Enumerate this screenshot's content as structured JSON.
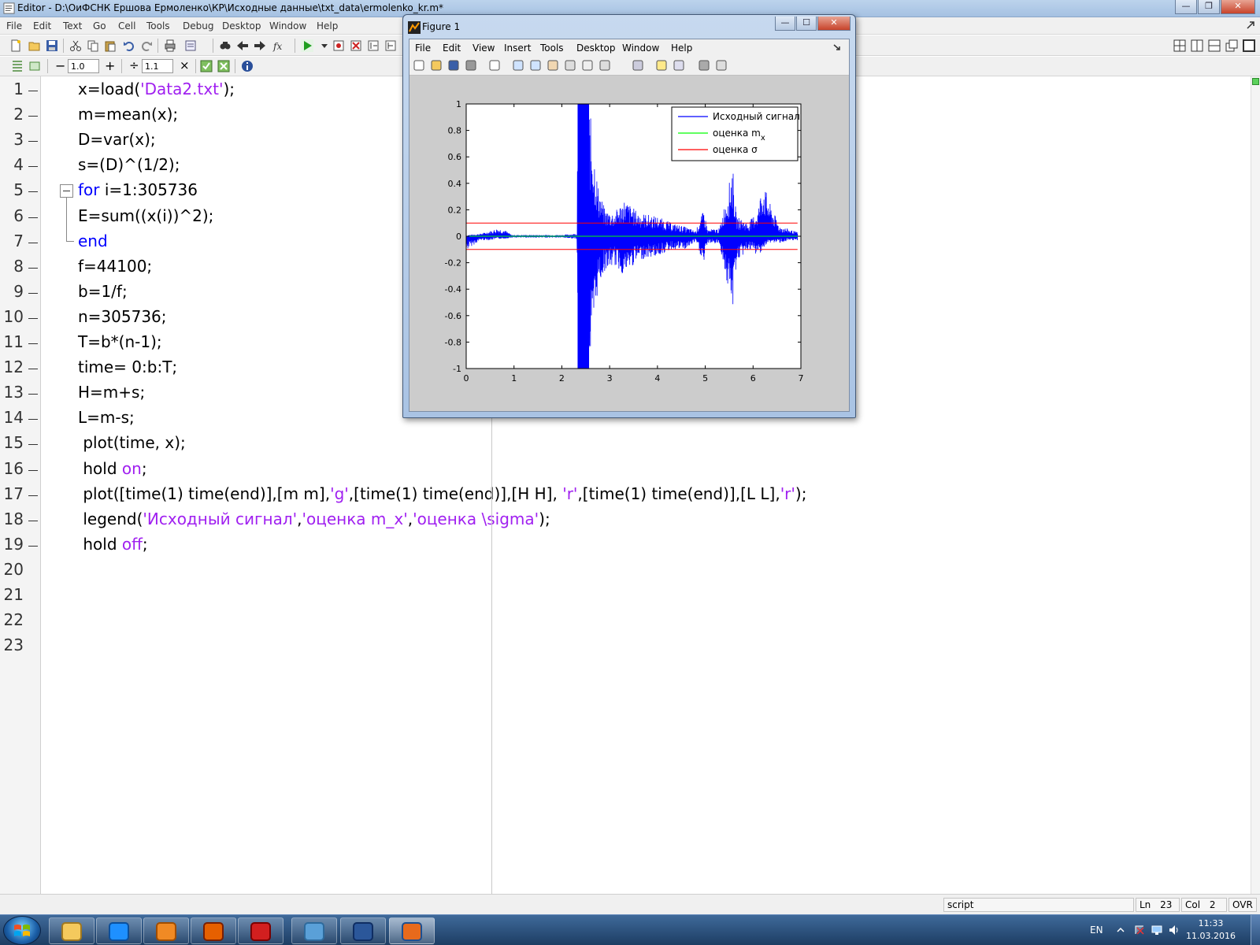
{
  "editor": {
    "title": "Editor - D:\\ОиФСНК Ершова Ермоленко\\КР\\Исходные данные\\txt_data\\ermolenko_kr.m*",
    "menu": [
      "File",
      "Edit",
      "Text",
      "Go",
      "Cell",
      "Tools",
      "Debug",
      "Desktop",
      "Window",
      "Help"
    ],
    "cell_toolbar": {
      "minus": "−",
      "value1": "1.0",
      "plus": "+",
      "divide": "÷",
      "value2": "1.1",
      "times": "×"
    },
    "line_numbers": [
      "1",
      "2",
      "3",
      "4",
      "5",
      "6",
      "7",
      "8",
      "9",
      "10",
      "11",
      "12",
      "13",
      "14",
      "15",
      "16",
      "17",
      "18",
      "19",
      "20",
      "21",
      "22",
      "23"
    ],
    "code": [
      [
        {
          "t": "x=load(",
          "c": ""
        },
        {
          "t": "'Data2.txt'",
          "c": "str"
        },
        {
          "t": ");",
          "c": ""
        }
      ],
      [
        {
          "t": "m=mean(x);",
          "c": ""
        }
      ],
      [
        {
          "t": "D=var(x);",
          "c": ""
        }
      ],
      [
        {
          "t": "s=(D)^(1/2);",
          "c": ""
        }
      ],
      [
        {
          "t": "for",
          "c": "kw"
        },
        {
          "t": " i=1:305736",
          "c": ""
        }
      ],
      [
        {
          "t": "E=sum((x(i))^2);",
          "c": ""
        }
      ],
      [
        {
          "t": "end",
          "c": "kw"
        }
      ],
      [
        {
          "t": "f=44100;",
          "c": ""
        }
      ],
      [
        {
          "t": "b=1/f;",
          "c": ""
        }
      ],
      [
        {
          "t": "n=305736;",
          "c": ""
        }
      ],
      [
        {
          "t": "T=b*(n-1);",
          "c": ""
        }
      ],
      [
        {
          "t": "time= 0:b:T;",
          "c": ""
        }
      ],
      [
        {
          "t": "H=m+s;",
          "c": ""
        }
      ],
      [
        {
          "t": "L=m-s;",
          "c": ""
        }
      ],
      [
        {
          "t": " plot(time, x);",
          "c": ""
        }
      ],
      [
        {
          "t": " hold ",
          "c": ""
        },
        {
          "t": "on",
          "c": "str"
        },
        {
          "t": ";",
          "c": ""
        }
      ],
      [
        {
          "t": " plot([time(1) time(end)],[m m],",
          "c": ""
        },
        {
          "t": "'g'",
          "c": "str"
        },
        {
          "t": ",[time(1) time(end)],[H H], ",
          "c": ""
        },
        {
          "t": "'r'",
          "c": "str"
        },
        {
          "t": ",[time(1) time(end)],[L L],",
          "c": ""
        },
        {
          "t": "'r'",
          "c": "str"
        },
        {
          "t": ");",
          "c": ""
        }
      ],
      [
        {
          "t": " legend(",
          "c": ""
        },
        {
          "t": "'Исходный сигнал'",
          "c": "str"
        },
        {
          "t": ",",
          "c": ""
        },
        {
          "t": "'оценка m_x'",
          "c": "str"
        },
        {
          "t": ",",
          "c": ""
        },
        {
          "t": "'оценка \\sigma'",
          "c": "str"
        },
        {
          "t": ");",
          "c": ""
        }
      ],
      [
        {
          "t": " hold ",
          "c": ""
        },
        {
          "t": "off",
          "c": "str"
        },
        {
          "t": ";",
          "c": ""
        }
      ],
      [],
      [],
      [],
      []
    ],
    "status": {
      "mode": "script",
      "ln_label": "Ln",
      "ln": "23",
      "col_label": "Col",
      "col": "2",
      "ovr": "OVR"
    }
  },
  "figure": {
    "title": "Figure 1",
    "menu": [
      "File",
      "Edit",
      "View",
      "Insert",
      "Tools",
      "Desktop",
      "Window",
      "Help"
    ],
    "icons": [
      "new-figure-icon",
      "open-file-icon",
      "save-icon",
      "print-icon",
      "pointer-icon",
      "zoom-in-icon",
      "zoom-out-icon",
      "pan-icon",
      "rotate-3d-icon",
      "data-cursor-icon",
      "brush-icon",
      "link-plot-icon",
      "colorbar-icon",
      "legend-icon",
      "hide-plot-tools-icon",
      "show-plot-tools-icon"
    ]
  },
  "chart_data": {
    "type": "line",
    "xlim": [
      0,
      7
    ],
    "ylim": [
      -1,
      1
    ],
    "x_ticks": [
      "0",
      "1",
      "2",
      "3",
      "4",
      "5",
      "6",
      "7"
    ],
    "y_ticks": [
      "1",
      "0.8",
      "0.6",
      "0.4",
      "0.2",
      "0",
      "-0.2",
      "-0.4",
      "-0.6",
      "-0.8",
      "-1"
    ],
    "grid": false,
    "legend_position": "top-right",
    "series": [
      {
        "name": "Исходный сигнал",
        "color": "#0000ff",
        "envelope": [
          {
            "x": 0.0,
            "upper": 0.0,
            "lower": -0.12
          },
          {
            "x": 0.05,
            "upper": 0.01,
            "lower": -0.09
          },
          {
            "x": 0.3,
            "upper": 0.02,
            "lower": -0.03
          },
          {
            "x": 0.5,
            "upper": 0.04,
            "lower": -0.03
          },
          {
            "x": 0.65,
            "upper": 0.06,
            "lower": -0.02
          },
          {
            "x": 0.8,
            "upper": 0.05,
            "lower": -0.02
          },
          {
            "x": 0.95,
            "upper": 0.01,
            "lower": -0.01
          },
          {
            "x": 2.0,
            "upper": 0.01,
            "lower": -0.01
          },
          {
            "x": 2.32,
            "upper": 0.02,
            "lower": -0.02
          },
          {
            "x": 2.33,
            "upper": 1.0,
            "lower": -1.0
          },
          {
            "x": 2.57,
            "upper": 1.0,
            "lower": -1.0
          },
          {
            "x": 2.65,
            "upper": 0.75,
            "lower": -0.9
          },
          {
            "x": 2.75,
            "upper": 0.4,
            "lower": -0.4
          },
          {
            "x": 2.9,
            "upper": 0.2,
            "lower": -0.26
          },
          {
            "x": 3.1,
            "upper": 0.18,
            "lower": -0.22
          },
          {
            "x": 3.3,
            "upper": 0.28,
            "lower": -0.3
          },
          {
            "x": 3.6,
            "upper": 0.18,
            "lower": -0.18
          },
          {
            "x": 4.0,
            "upper": 0.15,
            "lower": -0.15
          },
          {
            "x": 4.3,
            "upper": 0.1,
            "lower": -0.1
          },
          {
            "x": 4.6,
            "upper": 0.07,
            "lower": -0.1
          },
          {
            "x": 4.8,
            "upper": 0.04,
            "lower": -0.04
          },
          {
            "x": 4.97,
            "upper": 0.2,
            "lower": -0.22
          },
          {
            "x": 5.05,
            "upper": 0.05,
            "lower": -0.05
          },
          {
            "x": 5.3,
            "upper": 0.06,
            "lower": -0.06
          },
          {
            "x": 5.5,
            "upper": 0.4,
            "lower": -0.45
          },
          {
            "x": 5.57,
            "upper": 0.55,
            "lower": -0.6
          },
          {
            "x": 5.65,
            "upper": 0.15,
            "lower": -0.2
          },
          {
            "x": 5.9,
            "upper": 0.1,
            "lower": -0.1
          },
          {
            "x": 6.1,
            "upper": 0.2,
            "lower": -0.15
          },
          {
            "x": 6.2,
            "upper": 0.42,
            "lower": -0.1
          },
          {
            "x": 6.35,
            "upper": 0.25,
            "lower": -0.05
          },
          {
            "x": 6.55,
            "upper": 0.08,
            "lower": -0.05
          },
          {
            "x": 6.93,
            "upper": 0.03,
            "lower": -0.03
          }
        ]
      },
      {
        "name": "оценка m",
        "name_subscript": "x",
        "color": "#00ff00",
        "y": 0.0
      },
      {
        "name": "оценка σ",
        "color": "#ff0000",
        "y_upper": 0.1,
        "y_lower": -0.1
      }
    ]
  },
  "taskbar": {
    "apps": [
      "explorer-icon",
      "internet-explorer-icon",
      "media-player-icon",
      "firefox-icon",
      "acrobat-icon",
      "image-viewer-icon",
      "word-icon",
      "matlab-icon"
    ],
    "active_index": 7,
    "language": "EN",
    "time": "11:33",
    "date": "11.03.2016"
  }
}
